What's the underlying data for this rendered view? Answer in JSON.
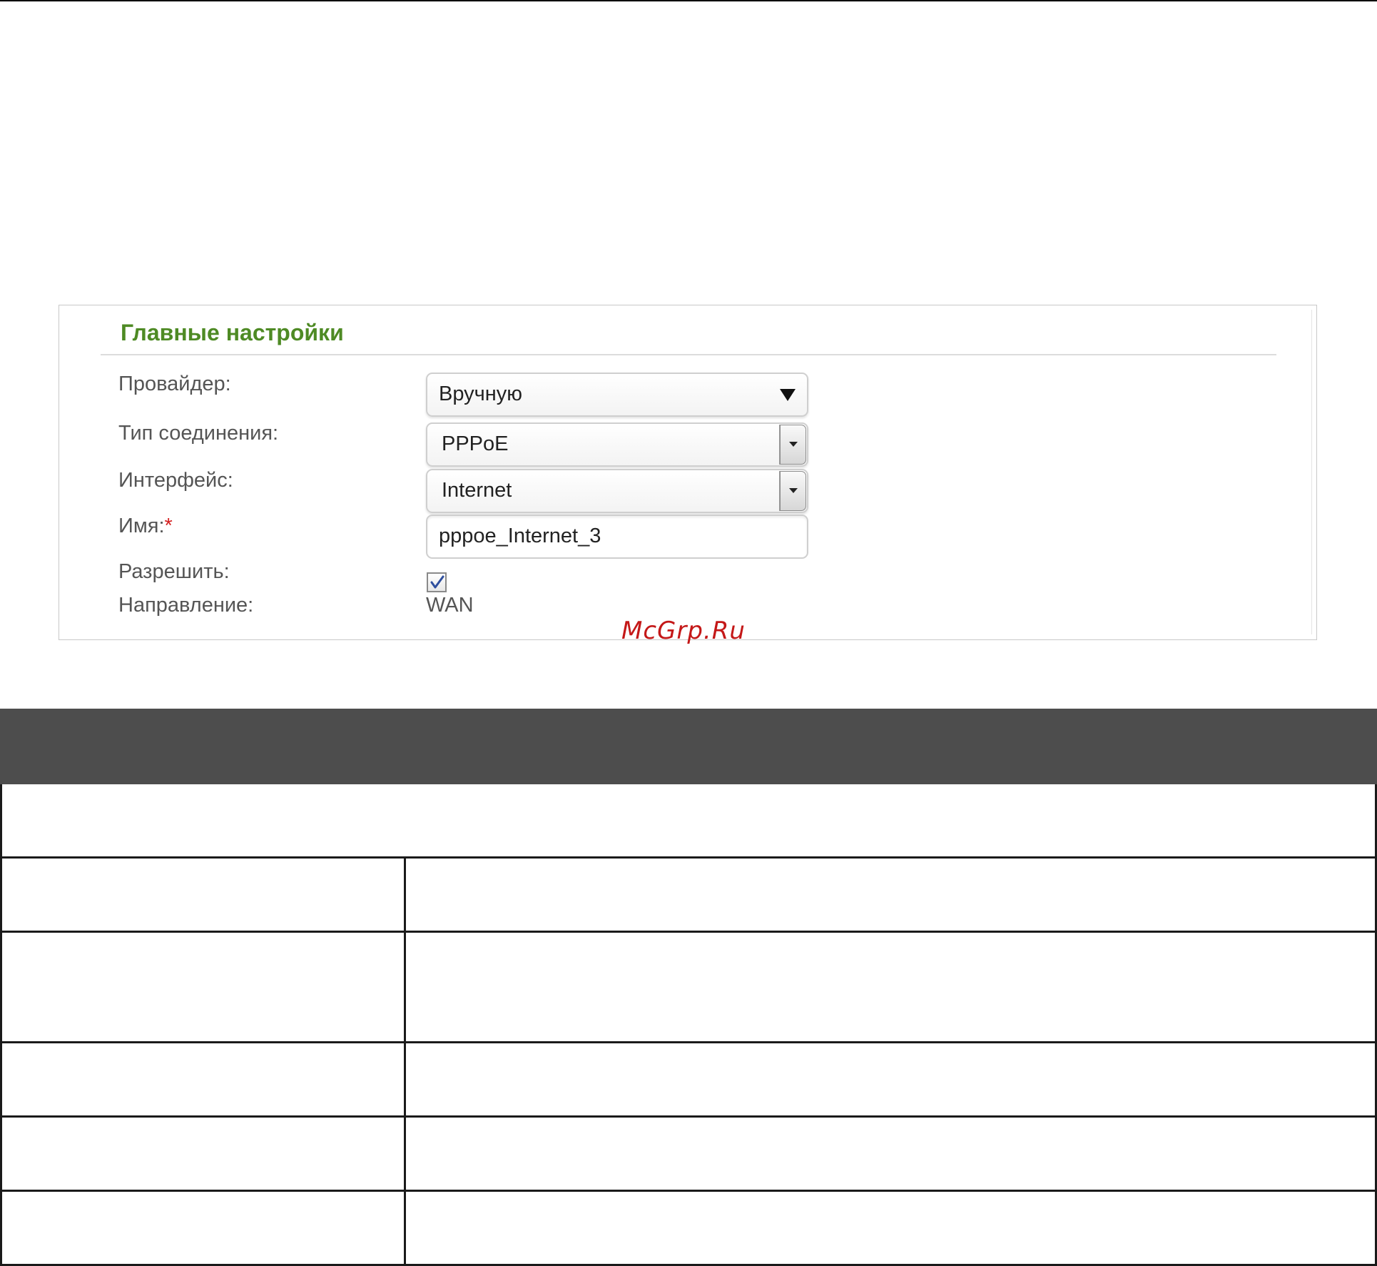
{
  "panel": {
    "title": "Главные настройки",
    "fields": {
      "provider": {
        "label": "Провайдер:",
        "value": "Вручную"
      },
      "connection_type": {
        "label": "Тип соединения:",
        "value": "PPPoE"
      },
      "interface": {
        "label": "Интерфейс:",
        "value": "Internet"
      },
      "name": {
        "label": "Имя:",
        "required_mark": "*",
        "value": "pppoe_Internet_3"
      },
      "enable": {
        "label": "Разрешить:",
        "checked": true
      },
      "direction": {
        "label": "Направление:",
        "value": "WAN"
      }
    }
  },
  "watermark": "McGrp.Ru",
  "colors": {
    "title_green": "#4e8a24",
    "table_header": "#4d4d4d",
    "watermark_red": "#c41818",
    "required_red": "#d42020"
  },
  "icons": {
    "dropdown": "triangle-down-icon",
    "checkbox": "checkmark-icon"
  }
}
